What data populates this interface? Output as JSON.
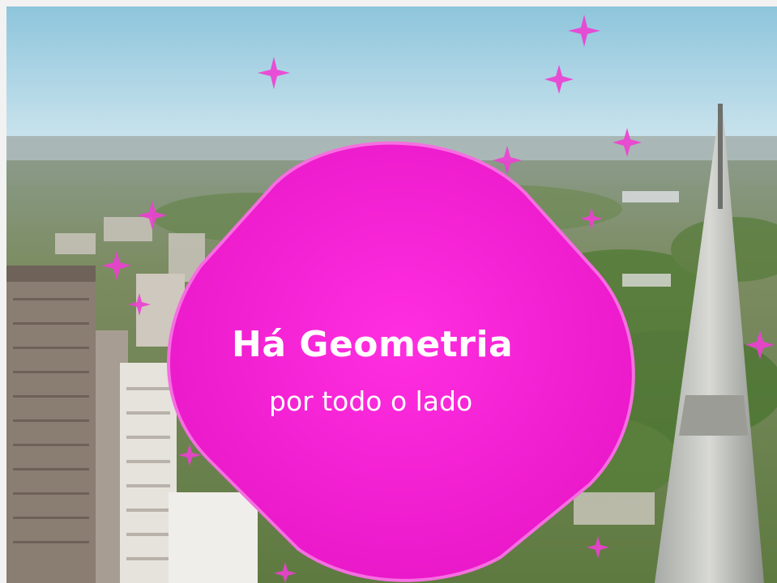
{
  "content": {
    "title": "Há Geometria",
    "subtitle": "por todo o lado"
  },
  "colors": {
    "accent_magenta": "#f21fd3",
    "sky_top": "#8fc6de",
    "sky_bottom": "#c9e3ec",
    "city_green": "#6c8a4a"
  },
  "decorations": {
    "icon": "sparkle-cross-icon"
  }
}
